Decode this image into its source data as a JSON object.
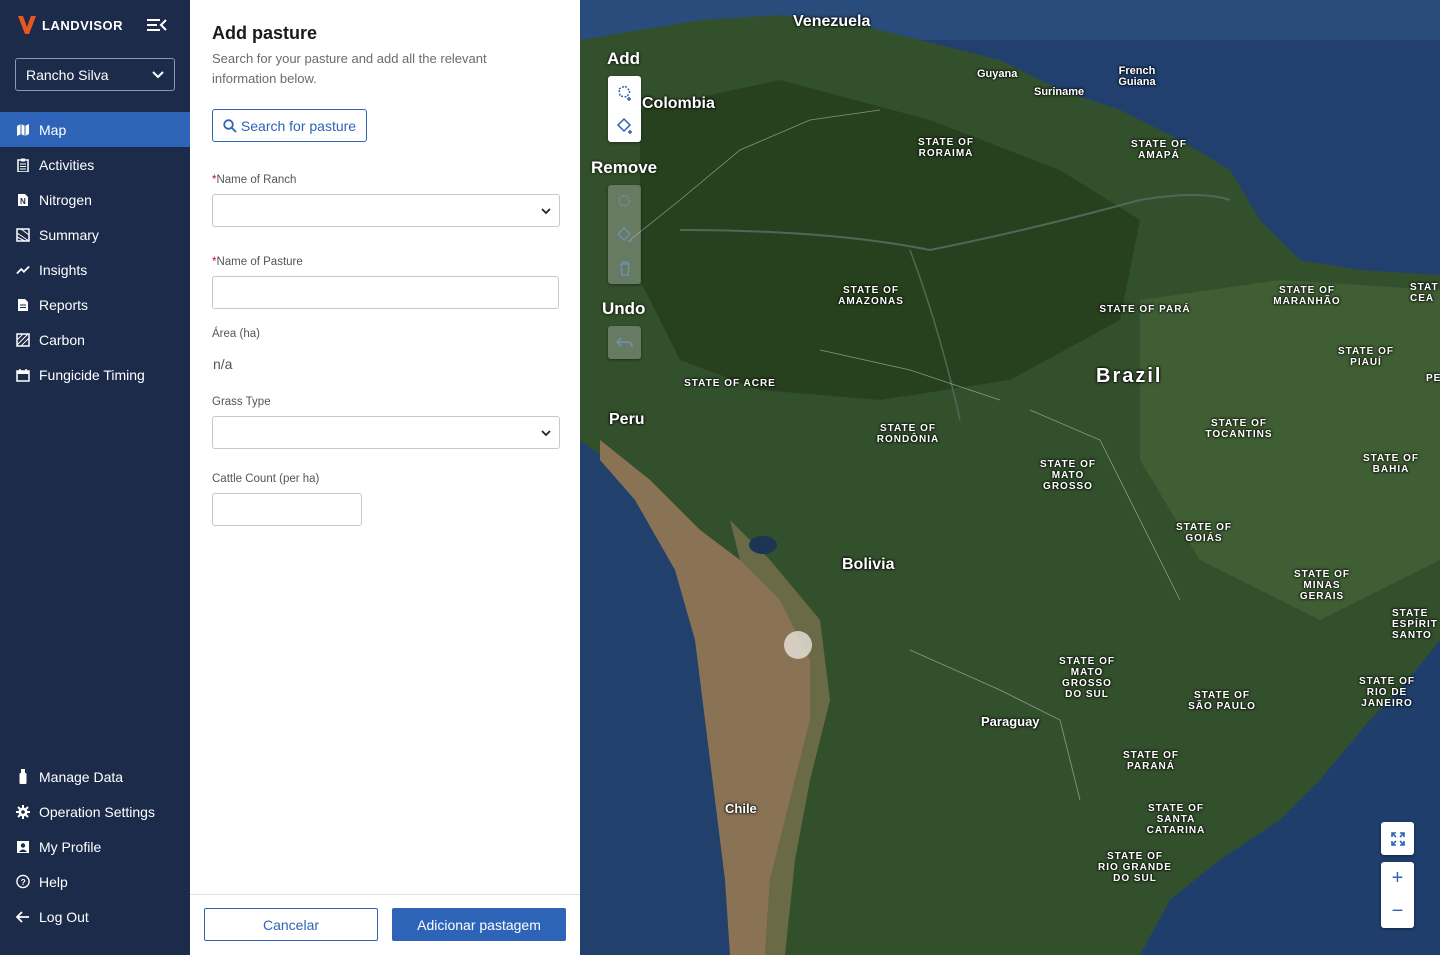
{
  "brand": {
    "name": "LANDVISOR",
    "primary": "#2e64b8",
    "sidebar_bg": "#1c2b4a"
  },
  "ranch_selector": {
    "value": "Rancho Silva"
  },
  "nav": {
    "items": [
      {
        "label": "Map",
        "icon": "map-icon",
        "active": true
      },
      {
        "label": "Activities",
        "icon": "clipboard-icon"
      },
      {
        "label": "Nitrogen",
        "icon": "nitrogen-icon"
      },
      {
        "label": "Summary",
        "icon": "summary-icon"
      },
      {
        "label": "Insights",
        "icon": "trend-icon"
      },
      {
        "label": "Reports",
        "icon": "report-icon"
      },
      {
        "label": "Carbon",
        "icon": "carbon-icon"
      },
      {
        "label": "Fungicide Timing",
        "icon": "calendar-icon"
      }
    ],
    "bottom": [
      {
        "label": "Manage Data",
        "icon": "usb-icon"
      },
      {
        "label": "Operation Settings",
        "icon": "gear-icon"
      },
      {
        "label": "My Profile",
        "icon": "profile-icon"
      },
      {
        "label": "Help",
        "icon": "help-icon"
      },
      {
        "label": "Log Out",
        "icon": "arrow-left-icon"
      }
    ]
  },
  "form": {
    "title": "Add pasture",
    "subtitle": "Search for your pasture and add all the relevant information below.",
    "search_label": "Search for pasture",
    "ranch_label": "Name of Ranch",
    "ranch_value": "",
    "pasture_label": "Name of Pasture",
    "pasture_value": "",
    "area_label": "Área (ha)",
    "area_value": "n/a",
    "grass_label": "Grass Type",
    "grass_value": "",
    "cattle_label": "Cattle Count (per ha)",
    "cattle_value": "",
    "required_mark": "*",
    "cancel_label": "Cancelar",
    "submit_label": "Adicionar pastagem"
  },
  "map": {
    "tools": {
      "add": "Add",
      "remove": "Remove",
      "undo": "Undo"
    },
    "countries": {
      "venezuela": "Venezuela",
      "colombia": "Colombia",
      "guyana": "Guyana",
      "suriname": "Suriname",
      "french_guiana": "French Guiana",
      "peru": "Peru",
      "brazil": "Brazil",
      "bolivia": "Bolivia",
      "paraguay": "Paraguay",
      "chile": "Chile"
    },
    "states": {
      "roraima": "STATE OF RORAIMA",
      "amapa": "STATE OF AMAPÁ",
      "amazonas": "STATE OF AMAZONAS",
      "para": "STATE OF PARÁ",
      "maranhao": "STATE OF MARANHÃO",
      "ceara": "STAT CEA",
      "piaui": "STATE OF PIAUÍ",
      "pe": "PE",
      "acre": "STATE OF ACRE",
      "rondonia": "STATE OF RONDÔNIA",
      "tocantins": "STATE OF TOCANTINS",
      "bahia": "STATE OF BAHIA",
      "mato_grosso": "STATE OF MATO GROSSO",
      "goias": "STATE OF GOIÁS",
      "minas_gerais": "STATE OF MINAS GERAIS",
      "espirito_santo": "STATE ESPÍRIT SANTO",
      "mato_grosso_do_sul": "STATE OF MATO GROSSO DO SUL",
      "rio_de_janeiro": "STATE OF RIO DE JANEIRO",
      "sao_paulo": "STATE OF SÃO PAULO",
      "parana": "STATE OF PARANÁ",
      "santa_catarina": "STATE OF SANTA CATARINA",
      "rio_grande_do_sul": "STATE OF RIO GRANDE DO SUL"
    },
    "zoom_in": "+",
    "zoom_out": "−"
  }
}
